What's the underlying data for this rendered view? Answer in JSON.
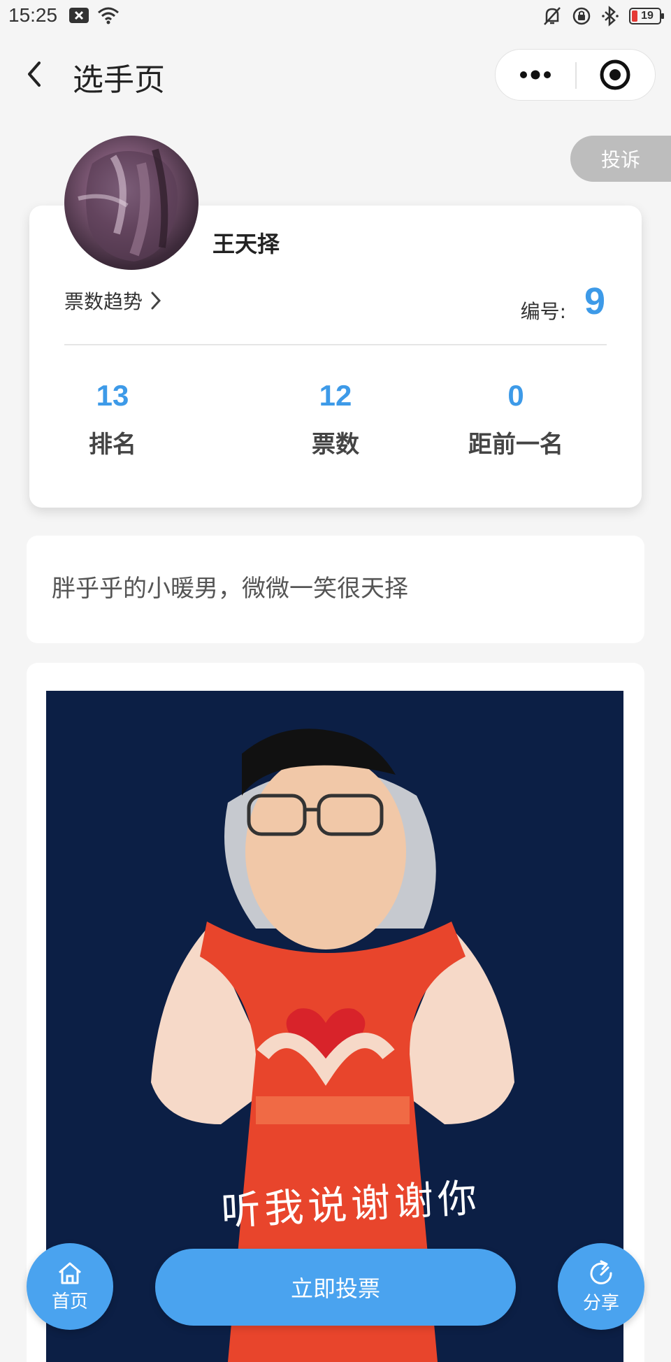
{
  "status_bar": {
    "time": "15:25",
    "battery_level": "19",
    "icons": [
      "x-notification-icon",
      "wifi-icon",
      "mute-icon",
      "lock-rotation-icon",
      "bluetooth-icon",
      "battery-icon"
    ]
  },
  "nav": {
    "title": "选手页",
    "back_icon": "back-arrow-icon",
    "more_icon": "more-dots-icon",
    "close_icon": "target-close-icon"
  },
  "complain_label": "投诉",
  "player": {
    "name": "王天择",
    "trend_label": "票数趋势",
    "number_label": "编号:",
    "number_value": "9",
    "stats": [
      {
        "value": "13",
        "label": "排名"
      },
      {
        "value": "12",
        "label": "票数"
      },
      {
        "value": "0",
        "label": "距前一名"
      }
    ]
  },
  "intro": {
    "text": "胖乎乎的小暖男，微微一笑很天择"
  },
  "photo": {
    "caption": "听我说谢谢你"
  },
  "bottom": {
    "home_label": "首页",
    "vote_label": "立即投票",
    "share_label": "分享"
  },
  "colors": {
    "accent": "#4aa3ef",
    "number_blue": "#3d9ae8",
    "photo_bg": "#0c1f45",
    "dress_red": "#e8452c"
  }
}
